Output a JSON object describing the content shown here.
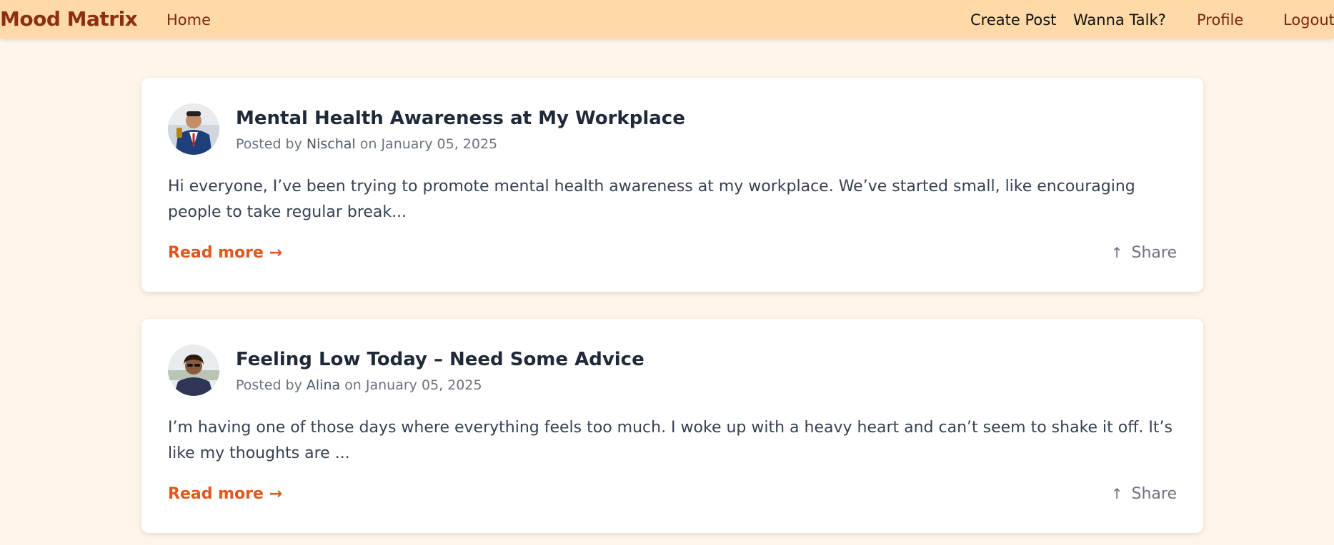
{
  "nav": {
    "brand": "Mood Matrix",
    "home": "Home",
    "create_post": "Create Post",
    "wanna_talk": "Wanna Talk?",
    "profile": "Profile",
    "logout": "Logout"
  },
  "posts": [
    {
      "title": "Mental Health Awareness at My Workplace",
      "posted_by_prefix": "Posted by ",
      "author": "Nischal",
      "date_prefix": " on ",
      "date": "January 05, 2025",
      "excerpt": "Hi everyone, I’ve been trying to promote mental health awareness at my workplace. We’ve started small, like encouraging people to take regular break...",
      "read_more": "Read more →",
      "share_icon": "↑",
      "share": "Share"
    },
    {
      "title": "Feeling Low Today – Need Some Advice",
      "posted_by_prefix": "Posted by ",
      "author": "Alina",
      "date_prefix": " on ",
      "date": "January 05, 2025",
      "excerpt": "I’m having one of those days where everything feels too much. I woke up with a heavy heart and can’t seem to shake it off. It’s like my thoughts are ...",
      "read_more": "Read more →",
      "share_icon": "↑",
      "share": "Share"
    }
  ],
  "colors": {
    "navbar_bg": "#ffd9a8",
    "page_bg": "#fff5ea",
    "brand": "#8b2f0c",
    "accent": "#e0561e"
  }
}
